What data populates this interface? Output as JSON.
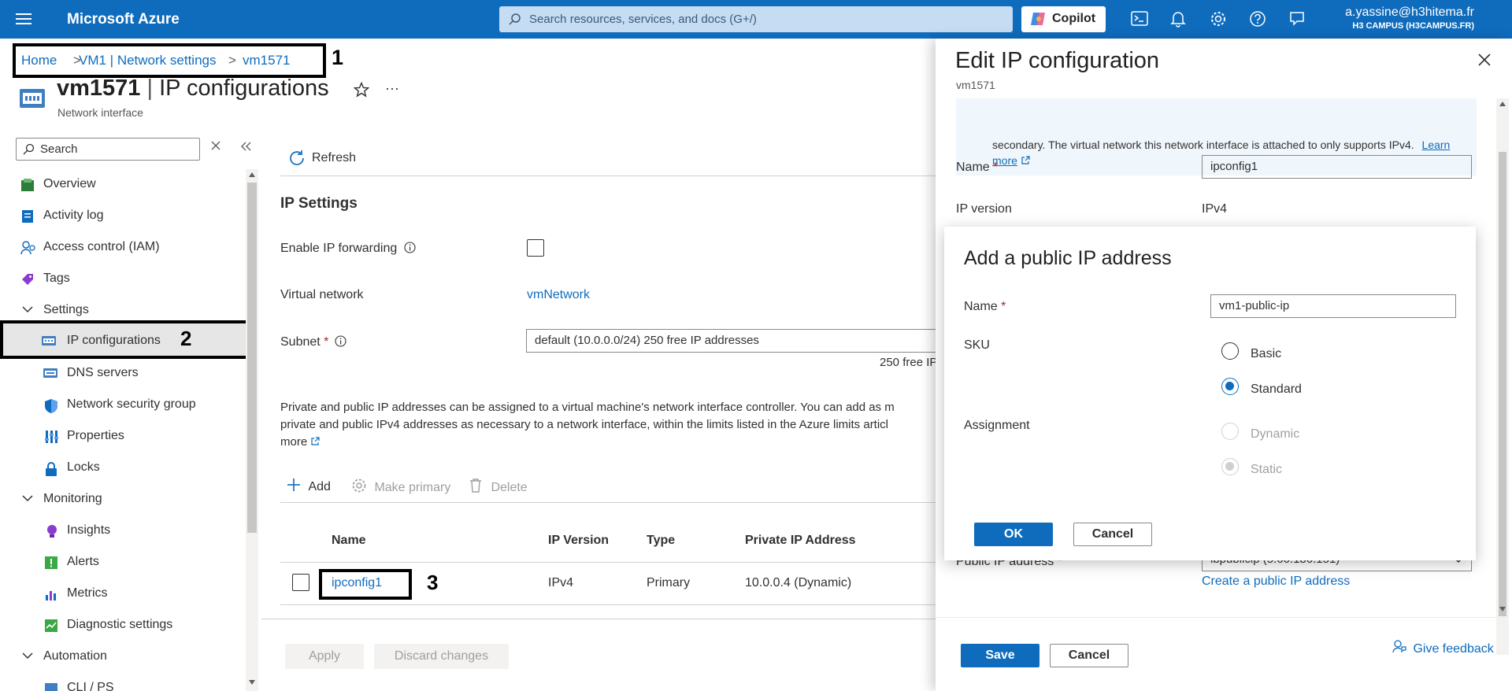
{
  "topbar": {
    "app_title": "Microsoft Azure",
    "search_placeholder": "Search resources, services, and docs (G+/)",
    "copilot_label": "Copilot",
    "user_email": "a.yassine@h3hitema.fr",
    "user_org": "H3 CAMPUS (H3CAMPUS.FR)"
  },
  "breadcrumb": {
    "items": [
      "Home",
      "VM1 | Network settings",
      "vm1571"
    ]
  },
  "annotations": [
    "1",
    "2",
    "3"
  ],
  "page": {
    "title_bold": "vm1571",
    "title_sep": " | ",
    "title_rest": "IP configurations",
    "subtitle": "Network interface"
  },
  "sidebar": {
    "search_placeholder": "Search",
    "items": [
      {
        "label": "Overview"
      },
      {
        "label": "Activity log"
      },
      {
        "label": "Access control (IAM)"
      },
      {
        "label": "Tags"
      },
      {
        "label": "Settings"
      },
      {
        "label": "IP configurations"
      },
      {
        "label": "DNS servers"
      },
      {
        "label": "Network security group"
      },
      {
        "label": "Properties"
      },
      {
        "label": "Locks"
      },
      {
        "label": "Monitoring"
      },
      {
        "label": "Insights"
      },
      {
        "label": "Alerts"
      },
      {
        "label": "Metrics"
      },
      {
        "label": "Diagnostic settings"
      },
      {
        "label": "Automation"
      },
      {
        "label": "CLI / PS"
      }
    ]
  },
  "main": {
    "refresh_label": "Refresh",
    "section_title": "IP Settings",
    "ip_forwarding_label": "Enable IP forwarding",
    "vnet_label": "Virtual network",
    "vnet_value": "vmNetwork",
    "subnet_label": "Subnet",
    "subnet_value": "default (10.0.0.0/24) 250 free IP addresses",
    "subnet_hint": "250 free IP",
    "description_line1": "Private and public IP addresses can be assigned to a virtual machine's network interface controller. You can add as m",
    "description_line2": "private and public IPv4 addresses as necessary to a network interface, within the limits listed in the Azure limits articl",
    "description_link": "more",
    "toolbar": {
      "add": "Add",
      "make_primary": "Make primary",
      "delete": "Delete"
    },
    "table": {
      "headers": [
        "Name",
        "IP Version",
        "Type",
        "Private IP Address"
      ],
      "rows": [
        {
          "name": "ipconfig1",
          "version": "IPv4",
          "type": "Primary",
          "private_ip": "10.0.0.4 (Dynamic)"
        }
      ]
    },
    "apply_label": "Apply",
    "discard_label": "Discard changes"
  },
  "edit_panel": {
    "title": "Edit IP configuration",
    "subtitle": "vm1571",
    "info_text": "secondary. The virtual network this network interface is attached to only supports IPv4.",
    "info_link": "Learn more",
    "name_label": "Name",
    "name_value": "ipconfig1",
    "ip_version_label": "IP version",
    "ip_version_value": "IPv4",
    "public_ip_label": "Public IP address",
    "public_ip_value": "lbpublicip (5.66.186.151)",
    "create_public_ip_link": "Create a public IP address",
    "save_label": "Save",
    "cancel_label": "Cancel",
    "feedback_label": "Give feedback"
  },
  "dialog": {
    "title": "Add a public IP address",
    "name_label": "Name",
    "name_value": "vm1-public-ip",
    "sku_label": "SKU",
    "sku_options": [
      "Basic",
      "Standard"
    ],
    "sku_selected": "Standard",
    "assignment_label": "Assignment",
    "assignment_options": [
      "Dynamic",
      "Static"
    ],
    "assignment_selected": "Static",
    "ok_label": "OK",
    "cancel_label": "Cancel"
  },
  "colors": {
    "accent": "#0f6cbd",
    "required": "#a4262c"
  }
}
